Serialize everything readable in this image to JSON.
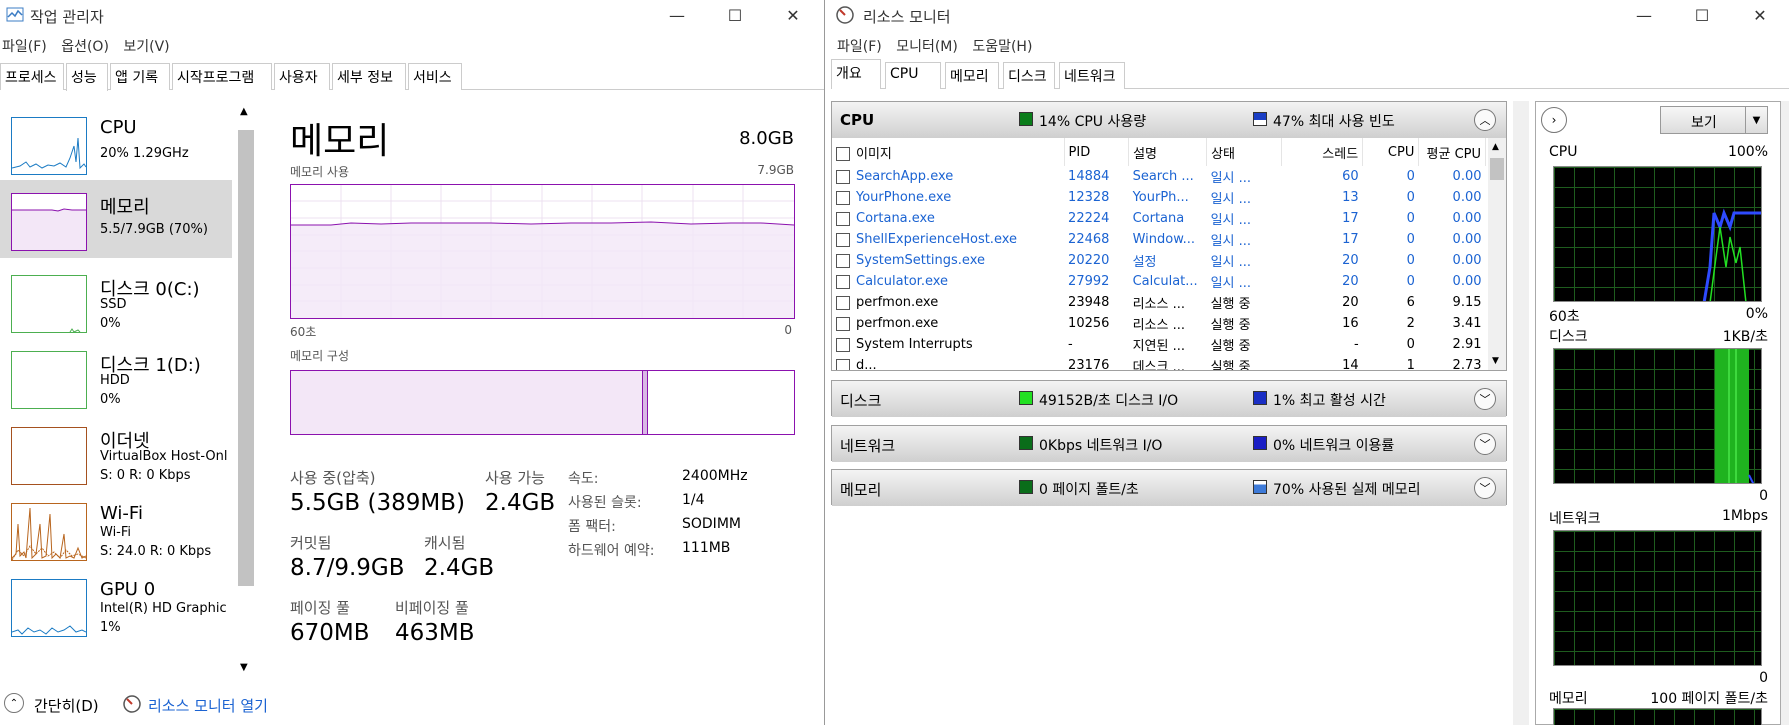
{
  "task_manager": {
    "title": "작업 관리자",
    "menu": [
      "파일(F)",
      "옵션(O)",
      "보기(V)"
    ],
    "tabs": [
      "프로세스",
      "성능",
      "앱 기록",
      "시작프로그램",
      "사용자",
      "세부 정보",
      "서비스"
    ],
    "selected_tab": "성능",
    "sidebar": [
      {
        "name": "CPU",
        "line1": "20% 1.29GHz",
        "line2": ""
      },
      {
        "name": "메모리",
        "line1": "5.5/7.9GB (70%)",
        "line2": ""
      },
      {
        "name": "디스크 0(C:)",
        "line1": "SSD",
        "line2": "0%"
      },
      {
        "name": "디스크 1(D:)",
        "line1": "HDD",
        "line2": "0%"
      },
      {
        "name": "이더넷",
        "line1": "VirtualBox Host-Onl",
        "line2": "S: 0 R: 0 Kbps"
      },
      {
        "name": "Wi-Fi",
        "line1": "Wi-Fi",
        "line2": "S: 24.0 R: 0 Kbps"
      },
      {
        "name": "GPU 0",
        "line1": "Intel(R) HD Graphic",
        "line2": "1%"
      }
    ],
    "main": {
      "title": "메모리",
      "total": "8.0GB",
      "usage_label": "메모리 사용",
      "usage_max": "7.9GB",
      "time_left": "60초",
      "time_right": "0",
      "composition_label": "메모리 구성",
      "in_use_label": "사용 중(압축)",
      "in_use_value": "5.5GB (389MB)",
      "available_label": "사용 가능",
      "available_value": "2.4GB",
      "committed_label": "커밋됨",
      "committed_value": "8.7/9.9GB",
      "cached_label": "캐시됨",
      "cached_value": "2.4GB",
      "paged_label": "페이징 풀",
      "paged_value": "670MB",
      "nonpaged_label": "비페이징 풀",
      "nonpaged_value": "463MB",
      "speed_label": "속도:",
      "speed_value": "2400MHz",
      "slots_label": "사용된 슬롯:",
      "slots_value": "1/4",
      "form_label": "폼 팩터:",
      "form_value": "SODIMM",
      "hwres_label": "하드웨어 예약:",
      "hwres_value": "111MB"
    },
    "footer": {
      "fewer": "간단히(D)",
      "open_rm": "리소스 모니터 열기"
    }
  },
  "resource_monitor": {
    "title": "리소스 모니터",
    "menu": [
      "파일(F)",
      "모니터(M)",
      "도움말(H)"
    ],
    "tabs": [
      "개요",
      "CPU",
      "메모리",
      "디스크",
      "네트워크"
    ],
    "cpu_panel": {
      "title": "CPU",
      "stat1": "14% CPU 사용량",
      "stat2": "47% 최대 사용 빈도",
      "columns": [
        "이미지",
        "PID",
        "설명",
        "상태",
        "스레드",
        "CPU",
        "평균 CPU"
      ],
      "rows": [
        {
          "image": "SearchApp.exe",
          "pid": "14884",
          "desc": "Search ...",
          "status": "일시 ...",
          "threads": "60",
          "cpu": "0",
          "avg": "0.00",
          "suspended": true
        },
        {
          "image": "YourPhone.exe",
          "pid": "12328",
          "desc": "YourPh...",
          "status": "일시 ...",
          "threads": "13",
          "cpu": "0",
          "avg": "0.00",
          "suspended": true
        },
        {
          "image": "Cortana.exe",
          "pid": "22224",
          "desc": "Cortana",
          "status": "일시 ...",
          "threads": "17",
          "cpu": "0",
          "avg": "0.00",
          "suspended": true
        },
        {
          "image": "ShellExperienceHost.exe",
          "pid": "22468",
          "desc": "Window...",
          "status": "일시 ...",
          "threads": "17",
          "cpu": "0",
          "avg": "0.00",
          "suspended": true
        },
        {
          "image": "SystemSettings.exe",
          "pid": "20220",
          "desc": "설정",
          "status": "일시 ...",
          "threads": "20",
          "cpu": "0",
          "avg": "0.00",
          "suspended": true
        },
        {
          "image": "Calculator.exe",
          "pid": "27992",
          "desc": "Calculat...",
          "status": "일시 ...",
          "threads": "20",
          "cpu": "0",
          "avg": "0.00",
          "suspended": true
        },
        {
          "image": "perfmon.exe",
          "pid": "23948",
          "desc": "리소스 ...",
          "status": "실행 중",
          "threads": "20",
          "cpu": "6",
          "avg": "9.15",
          "suspended": false
        },
        {
          "image": "perfmon.exe",
          "pid": "10256",
          "desc": "리소스 ...",
          "status": "실행 중",
          "threads": "16",
          "cpu": "2",
          "avg": "3.41",
          "suspended": false
        },
        {
          "image": "System Interrupts",
          "pid": "-",
          "desc": "지연된 ...",
          "status": "실행 중",
          "threads": "-",
          "cpu": "0",
          "avg": "2.91",
          "suspended": false
        },
        {
          "image": "d...",
          "pid": "23176",
          "desc": "데스크 ...",
          "status": "실행 중",
          "threads": "14",
          "cpu": "1",
          "avg": "2.73",
          "suspended": false
        }
      ]
    },
    "disk_panel": {
      "title": "디스크",
      "stat1": "49152B/초 디스크 I/O",
      "stat2": "1% 최고 활성 시간"
    },
    "net_panel": {
      "title": "네트워크",
      "stat1": "0Kbps 네트워크 I/O",
      "stat2": "0% 네트워크 이용률"
    },
    "mem_panel": {
      "title": "메모리",
      "stat1": "0 페이지 폴트/초",
      "stat2": "70% 사용된 실제 메모리"
    },
    "right": {
      "view_button": "보기",
      "cpu_label": "CPU",
      "cpu_max": "100%",
      "cpu_time": "60초",
      "cpu_min": "0%",
      "disk_label": "디스크",
      "disk_max": "1KB/초",
      "disk_min": "0",
      "net_label": "네트워크",
      "net_max": "1Mbps",
      "net_min": "0",
      "mem_label": "메모리",
      "mem_max": "100 페이지 폴트/초"
    }
  },
  "colors": {
    "memory_graph": "#8b12ae",
    "cpu_graph": "#1b7bc4",
    "ethernet_graph": "#a5511f",
    "wifi_graph": "#b8651e",
    "disk_graph": "#4caf50",
    "link": "#1b63d2"
  }
}
